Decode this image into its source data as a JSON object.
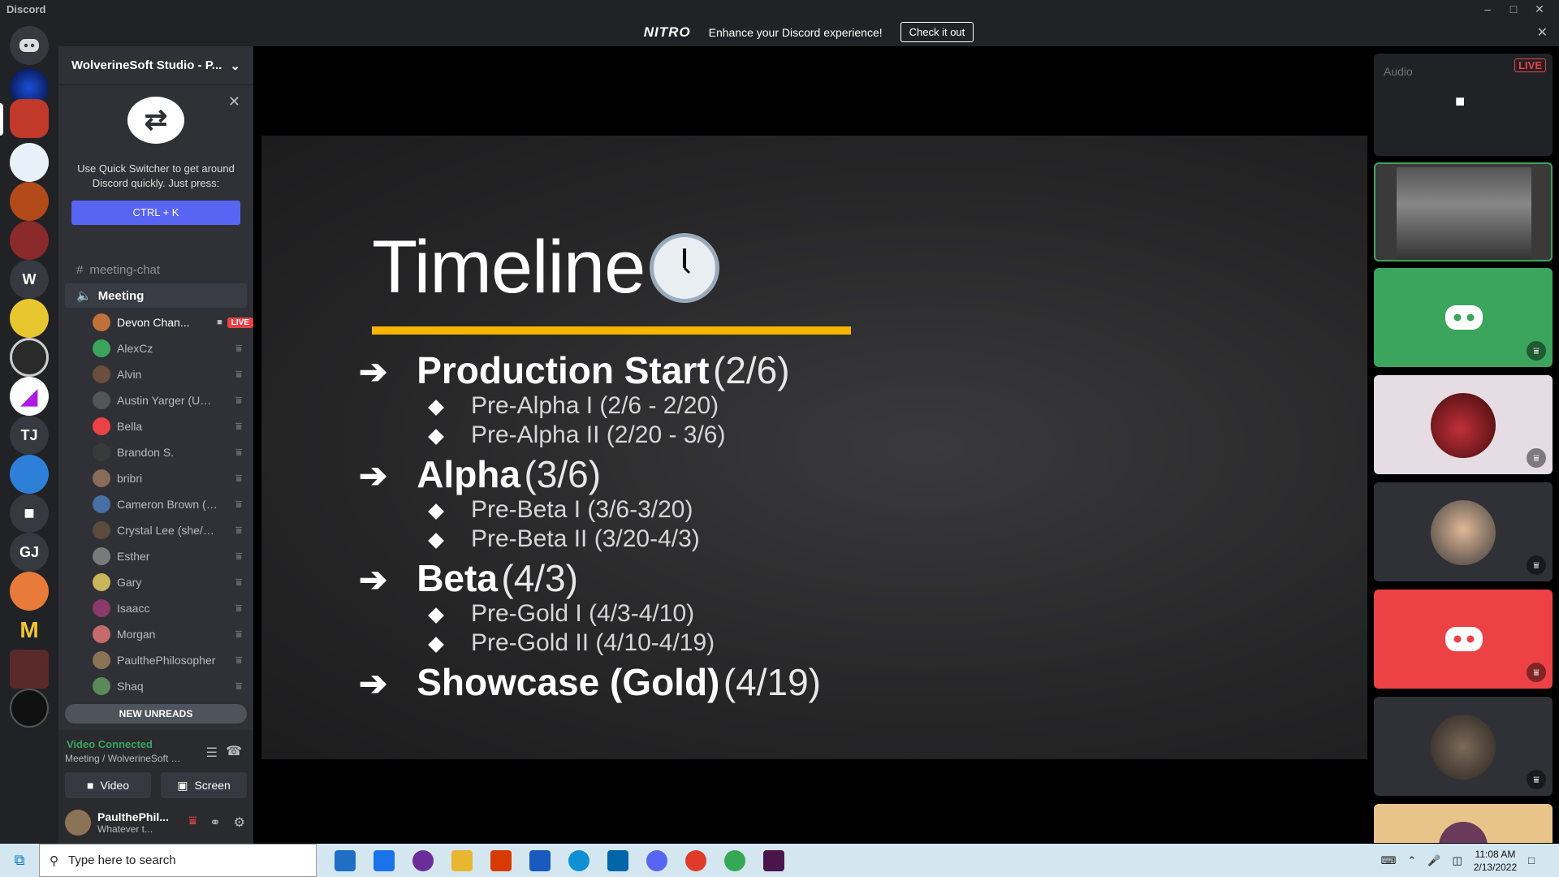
{
  "app": {
    "title": "Discord"
  },
  "banner": {
    "logo": "NITRO",
    "text": "Enhance your Discord experience!",
    "cta": "Check it out"
  },
  "servers": [
    "W",
    "TJ",
    "GJ"
  ],
  "guild": {
    "name": "WolverineSoft Studio - P..."
  },
  "quick_switcher": {
    "description": "Use Quick Switcher to get around Discord quickly. Just press:",
    "shortcut": "CTRL + K"
  },
  "channels": {
    "text": "meeting-chat",
    "voice": "Meeting"
  },
  "members": [
    {
      "name": "Devon Chan...",
      "live": "LIVE",
      "color": "#c0713a"
    },
    {
      "name": "AlexCz",
      "color": "#3ba55d"
    },
    {
      "name": "Alvin",
      "color": "#6b4e3d"
    },
    {
      "name": "Austin Yarger (UMi...",
      "color": "#555"
    },
    {
      "name": "Bella",
      "color": "#ed4245"
    },
    {
      "name": "Brandon S.",
      "color": "#3a3a3a"
    },
    {
      "name": "bribri",
      "color": "#8a6b5a"
    },
    {
      "name": "Cameron Brown (H...",
      "color": "#4a6fa5"
    },
    {
      "name": "Crystal Lee (she/her)",
      "color": "#5c4a3d"
    },
    {
      "name": "Esther",
      "color": "#7a7a7a"
    },
    {
      "name": "Gary",
      "color": "#c9b55a"
    },
    {
      "name": "Isaacc",
      "color": "#8a3a6a"
    },
    {
      "name": "Morgan",
      "color": "#c46b6b"
    },
    {
      "name": "PaulthePhilosopher",
      "color": "#8b7355"
    },
    {
      "name": "Shaq",
      "color": "#5a8a5a"
    }
  ],
  "new_unreads": "NEW UNREADS",
  "voice": {
    "status": "Video Connected",
    "location": "Meeting / WolverineSoft St...",
    "video_label": "Video",
    "screen_label": "Screen"
  },
  "user": {
    "name": "PaulthePhil...",
    "status": "Whatever t..."
  },
  "slide": {
    "title": "Timeline",
    "items": [
      {
        "bold": "Production Start",
        "date": "(2/6)",
        "subs": [
          "Pre-Alpha I (2/6 - 2/20)",
          "Pre-Alpha II (2/20 - 3/6)"
        ]
      },
      {
        "bold": "Alpha",
        "date": "(3/6)",
        "subs": [
          "Pre-Beta I (3/6-3/20)",
          "Pre-Beta II (3/20-4/3)"
        ]
      },
      {
        "bold": "Beta",
        "date": "(4/3)",
        "subs": [
          "Pre-Gold I (4/3-4/10)",
          "Pre-Gold II (4/10-4/19)"
        ]
      },
      {
        "bold": "Showcase (Gold)",
        "date": "(4/19)",
        "subs": []
      }
    ]
  },
  "preview": {
    "audio_label": "Audio",
    "live_label": "LIVE"
  },
  "taskbar": {
    "search_placeholder": "Type here to search",
    "time": "11:08 AM",
    "date": "2/13/2022"
  }
}
